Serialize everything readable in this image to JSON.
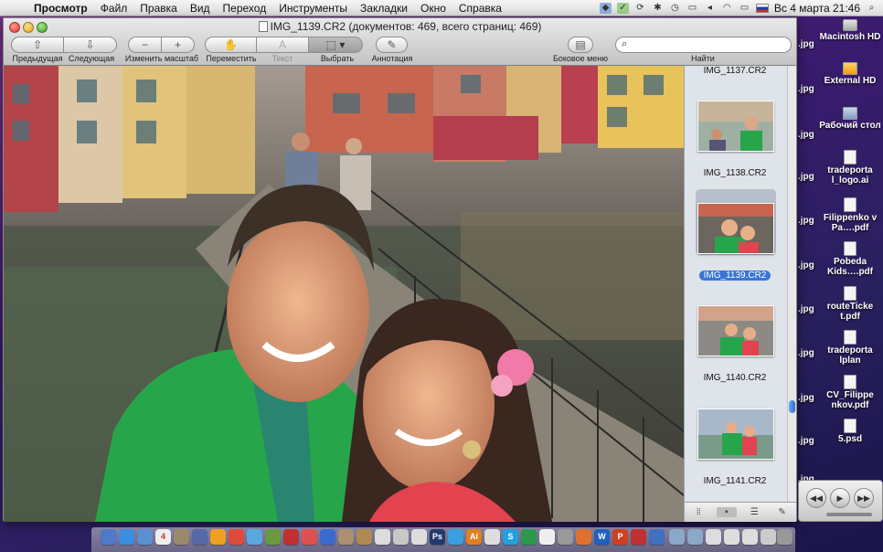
{
  "menubar": {
    "apple": "",
    "items": [
      "Просмотр",
      "Файл",
      "Правка",
      "Вид",
      "Переход",
      "Инструменты",
      "Закладки",
      "Окно",
      "Справка"
    ],
    "clock": "Вс 4 марта  21:46"
  },
  "window": {
    "title": "IMG_1139.CR2 (документов: 469, всего страниц: 469)",
    "toolbar": {
      "prev_label": "Предыдущая",
      "next_label": "Следующая",
      "zoom_label": "Изменить масштаб",
      "move_label": "Переместить",
      "text_label": "Текст",
      "select_label": "Выбрать",
      "annotate_label": "Аннотация",
      "sidebar_label": "Боковое меню",
      "search_label": "Найти",
      "search_value": ""
    }
  },
  "sidebar": {
    "thumbs": [
      "IMG_1137.CR2",
      "IMG_1138.CR2",
      "IMG_1139.CR2",
      "IMG_1140.CR2",
      "IMG_1141.CR2"
    ],
    "selected_index": 2
  },
  "desktop": {
    "icons": [
      "Macintosh HD",
      "External HD",
      "Рабочий стол",
      "tradeporta l_logo.ai",
      "Filippenko v Pa….pdf",
      "Pobeda Kids….pdf",
      "routeTicke t.pdf",
      "tradeporta lplan",
      "CV_Filippe nkov.pdf",
      "5.psd"
    ],
    "jpg_labels": [
      ".jpg",
      ".jpg",
      ".jpg",
      ".jpg",
      ".jpg",
      ".jpg",
      ".jpg",
      ".jpg",
      ".jpg",
      ".jpg",
      ".jpg"
    ]
  },
  "colors": {
    "selection": "#3a74d8",
    "desktop": "#3a1b6e"
  }
}
